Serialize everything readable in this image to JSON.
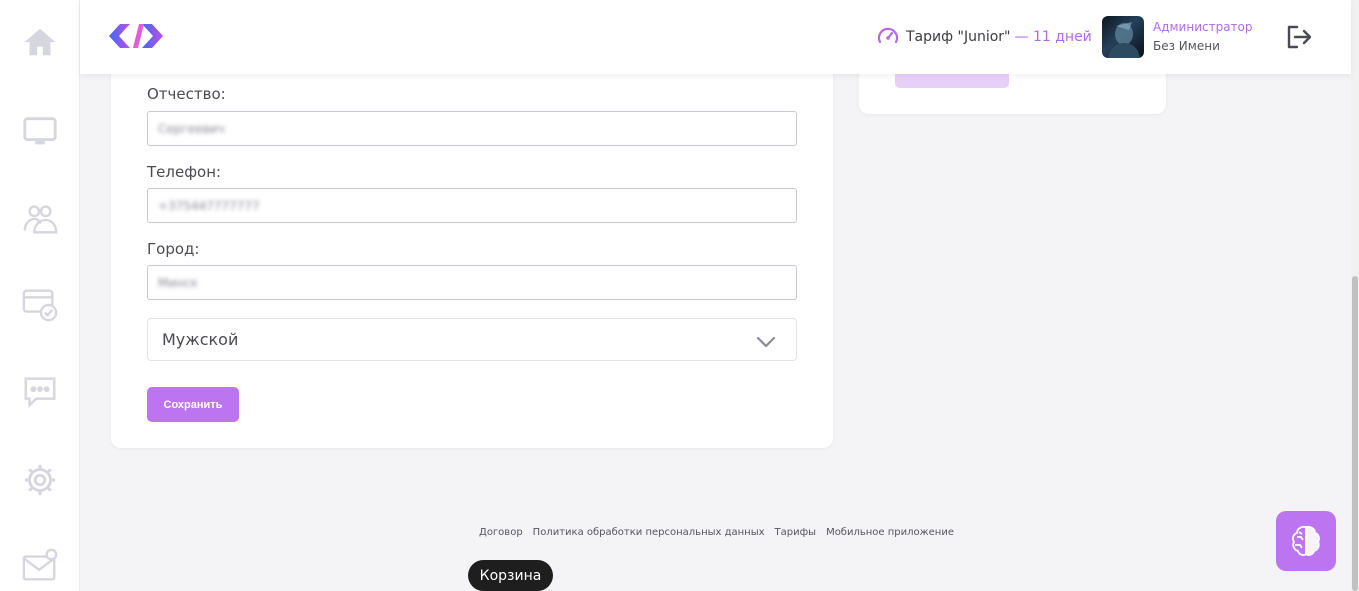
{
  "header": {
    "tariff_name": "Тариф \"Junior\"",
    "tariff_days": "— 11 дней",
    "user_role": "Администратор",
    "user_name": "Без Имени"
  },
  "sidebar": {
    "items": [
      {
        "icon": "home-icon"
      },
      {
        "icon": "monitor-icon"
      },
      {
        "icon": "users-icon"
      },
      {
        "icon": "payment-card-icon"
      },
      {
        "icon": "chat-icon"
      },
      {
        "icon": "gear-icon"
      },
      {
        "icon": "mail-notification-icon"
      }
    ]
  },
  "form": {
    "patronymic_label": "Отчество:",
    "patronymic_value": "Сергеевич",
    "phone_label": "Телефон:",
    "phone_value": "+375447777777",
    "city_label": "Город:",
    "city_value": "Минск",
    "gender_selected": "Мужской",
    "save_label": "Сохранить"
  },
  "footer": {
    "links": [
      "Договор",
      "Политика обработки персональных данных",
      "Тарифы",
      "Мобильное приложение"
    ],
    "cart_tooltip": "Корзина"
  },
  "colors": {
    "accent": "#bd74f0",
    "accent_text": "#b06ae8",
    "tooltip_bg": "#1e1e1e"
  }
}
